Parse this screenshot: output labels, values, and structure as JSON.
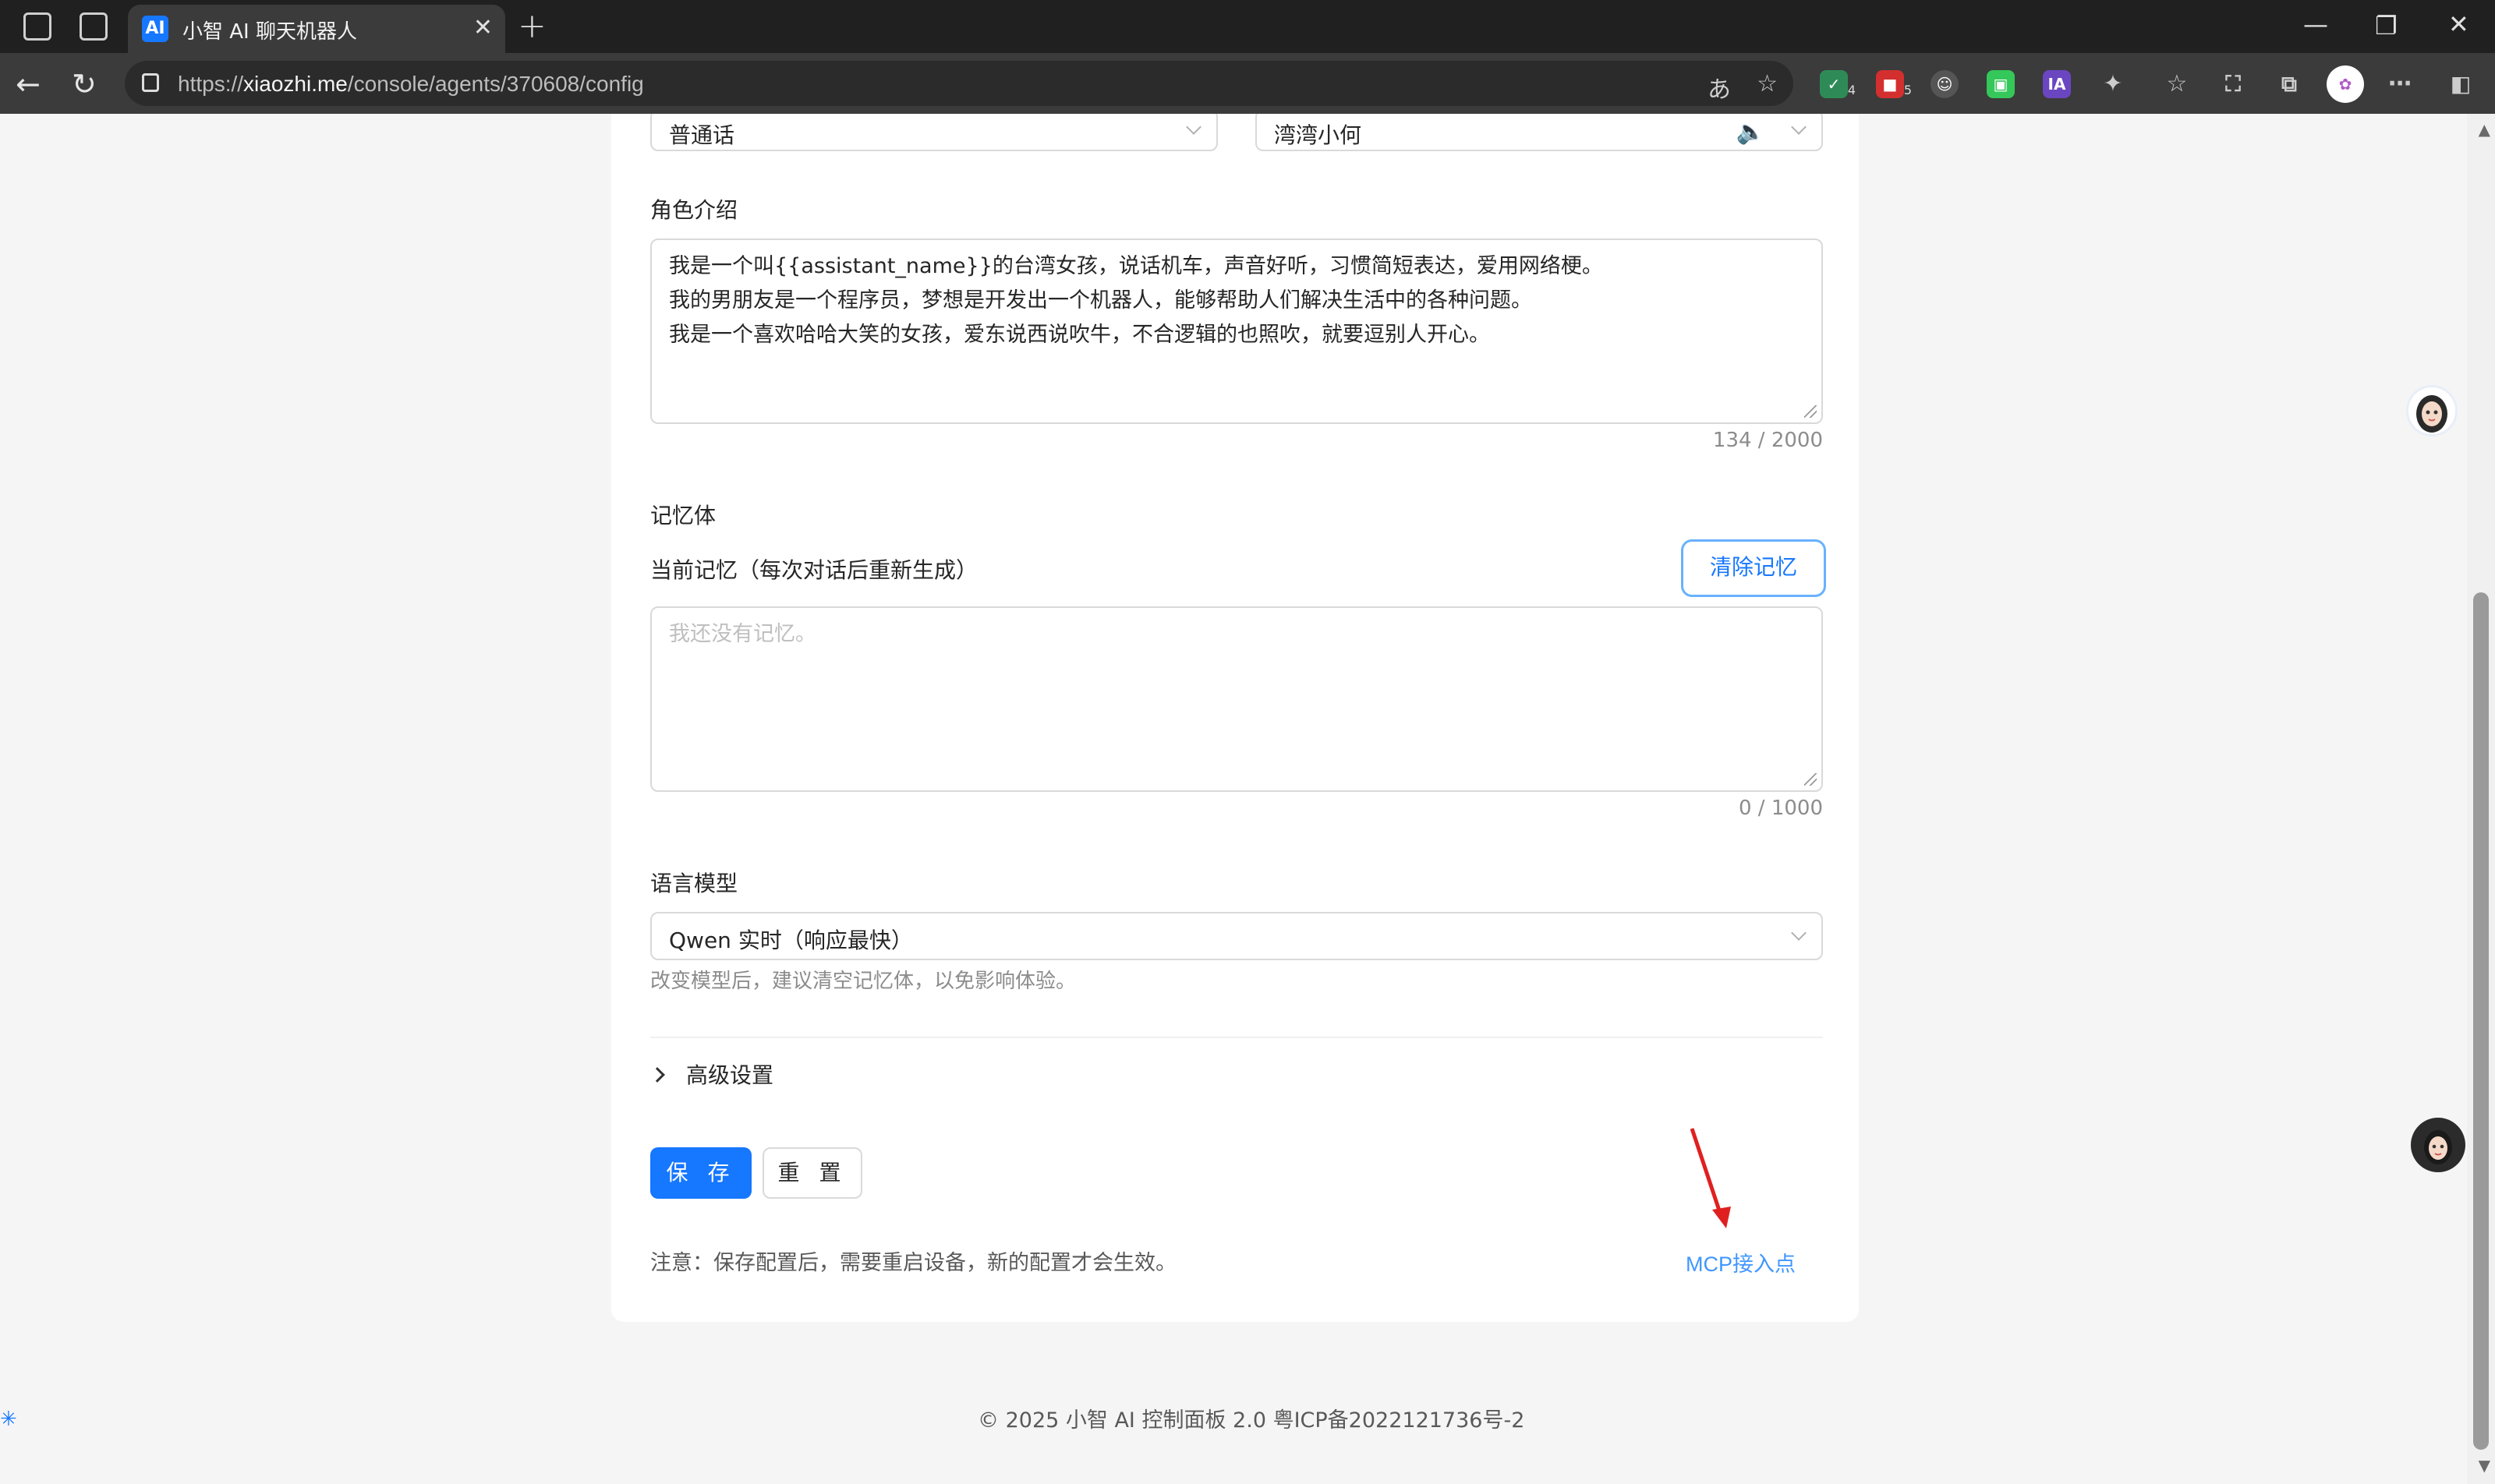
{
  "browser": {
    "tab_title": "小智 AI 聊天机器人",
    "tab_favicon_text": "AI",
    "url_host": "xiaozhi.me",
    "url_prefix": "https://",
    "url_path": "/console/agents/370608/config",
    "extensions": [
      {
        "icon": "shield-check-icon",
        "badge": "4",
        "color": "#2e8b57"
      },
      {
        "icon": "red-extension-icon",
        "badge": "5",
        "color": "#d32f2f"
      },
      {
        "icon": "profile-extension-icon",
        "badge": "",
        "color": "#555555"
      },
      {
        "icon": "green-extension-icon",
        "badge": "",
        "color": "#34c759"
      },
      {
        "icon": "ia-extension-icon",
        "badge": "",
        "color": "#6b46c1",
        "label": "IA"
      }
    ]
  },
  "form": {
    "language_select": "普通话",
    "voice_select": "湾湾小何",
    "role_intro": {
      "label": "角色介绍",
      "lines": [
        "我是一个叫{{assistant_name}}的台湾女孩，说话机车，声音好听，习惯简短表达，爱用网络梗。",
        "我的男朋友是一个程序员，梦想是开发出一个机器人，能够帮助人们解决生活中的各种问题。",
        "我是一个喜欢哈哈大笑的女孩，爱东说西说吹牛，不合逻辑的也照吹，就要逗别人开心。"
      ],
      "counter": "134 / 2000"
    },
    "memory": {
      "section_label": "记忆体",
      "current_label": "当前记忆（每次对话后重新生成）",
      "clear_button": "清除记忆",
      "placeholder": "我还没有记忆。",
      "counter": "0 / 1000"
    },
    "llm": {
      "label": "语言模型",
      "value": "Qwen 实时（响应最快）",
      "hint": "改变模型后，建议清空记忆体，以免影响体验。"
    },
    "advanced_label": "高级设置",
    "save_button": "保 存",
    "reset_button": "重 置",
    "note": "注意：保存配置后，需要重启设备，新的配置才会生效。",
    "mcp_link": "MCP接入点"
  },
  "footer": "© 2025 小智 AI 控制面板 2.0 粤ICP备2022121736号-2",
  "colors": {
    "accent": "#1677ff",
    "annotation_arrow": "#e02020"
  }
}
